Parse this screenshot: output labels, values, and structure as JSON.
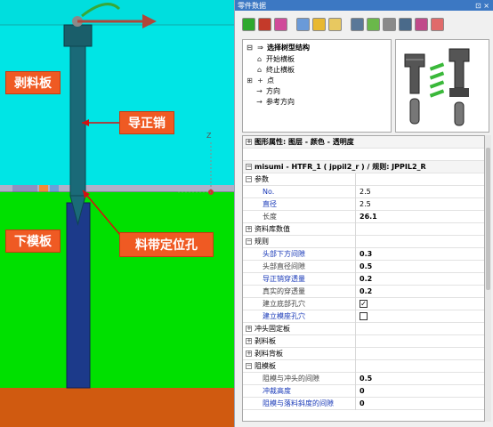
{
  "viewport": {
    "callouts": {
      "stripper_plate": "剥料板",
      "pilot_pin": "导正销",
      "lower_die_plate": "下模板",
      "strip_locating_hole": "料带定位孔"
    },
    "axis_label": "Z"
  },
  "panel": {
    "title": "零件数据",
    "title_controls": "⊡ ×",
    "toolbar_icons": [
      "check-icon",
      "pin-icon",
      "eraser-icon",
      "copy-icon",
      "open-folder-icon",
      "save-folder-icon",
      "search-icon",
      "settings-icon",
      "bolt-icon",
      "punch-icon",
      "stamp-icon",
      "heart-icon"
    ],
    "tree": {
      "root": "选择树型结构",
      "items": [
        "开始横板",
        "终止横板",
        "点",
        "方向",
        "参考方向"
      ]
    },
    "properties": {
      "header1": "图形属性: 图层 - 颜色 - 透明度",
      "header2": "misumi - HTFR_1 ( jppil2_r ) / 规则: JPPIL2_R",
      "groups": {
        "params": "参数",
        "no_label": "No.",
        "no_value": "2.5",
        "diameter_label": "直径",
        "diameter_value": "2.5",
        "length_label": "长度",
        "length_value": "26.1",
        "library_values": "资料库数值",
        "rules": "规则",
        "head_gap_label": "头部下方间隙",
        "head_gap_value": "0.3",
        "head_dia_gap_label": "头部直径间隙",
        "head_dia_gap_value": "0.5",
        "pilot_depth_label": "导正销穿透量",
        "pilot_depth_value": "0.2",
        "real_depth_label": "真实的穿透量",
        "real_depth_value": "0.2",
        "bottom_hole_label": "建立底部孔穴",
        "bottom_hole_checked": true,
        "seat_hole_label": "建立模座孔穴",
        "seat_hole_checked": false,
        "punch_holder": "冲头固定板",
        "stripper": "剥料板",
        "stripper_back": "剥料背板",
        "stop_plate": "阻模板",
        "stop_punch_gap_label": "阻模与冲头的间隙",
        "stop_punch_gap_value": "0.5",
        "punch_height_label": "冲裁高度",
        "punch_height_value": "0",
        "slope_gap_label": "阻模与落料斜度的间隙",
        "slope_gap_value": "0"
      }
    }
  }
}
